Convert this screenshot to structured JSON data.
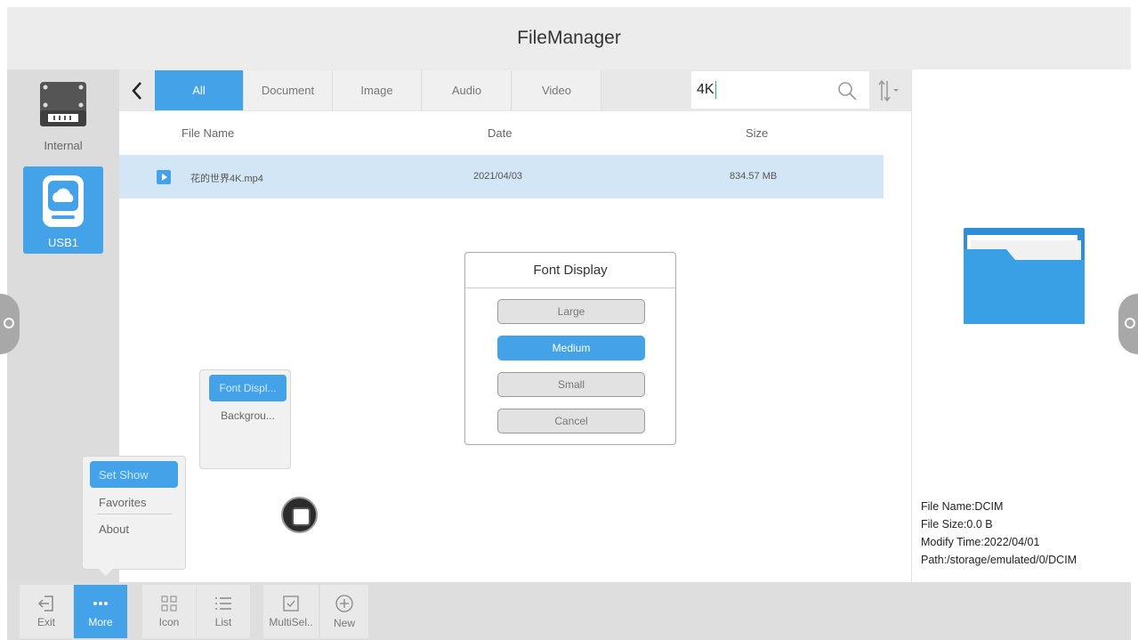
{
  "app": {
    "title": "FileManager"
  },
  "sidebar": {
    "devices": [
      {
        "label": "Internal",
        "icon": "internal-storage-icon",
        "active": false
      },
      {
        "label": "USB1",
        "icon": "usb-drive-icon",
        "active": true
      }
    ]
  },
  "tabs": [
    {
      "label": "All",
      "active": true
    },
    {
      "label": "Document",
      "active": false
    },
    {
      "label": "Image",
      "active": false
    },
    {
      "label": "Audio",
      "active": false
    },
    {
      "label": "Video",
      "active": false
    }
  ],
  "search": {
    "value": "4K"
  },
  "list": {
    "headers": {
      "name": "File Name",
      "date": "Date",
      "size": "Size"
    },
    "rows": [
      {
        "name": "花的世界4K.mp4",
        "date": "2021/04/03",
        "size": "834.57 MB",
        "icon": "video-file-icon"
      }
    ]
  },
  "details": {
    "file_name": "File Name:DCIM",
    "file_size": "File Size:0.0 B",
    "modify_time": "Modify Time:2022/04/01",
    "path": "Path:/storage/emulated/0/DCIM"
  },
  "dialog": {
    "title": "Font Display",
    "options": [
      "Large",
      "Medium",
      "Small"
    ],
    "selected": "Medium",
    "cancel": "Cancel"
  },
  "submenu": {
    "items": [
      "Font Displ...",
      "Backgrou..."
    ]
  },
  "more_menu": {
    "items": [
      "Set Show",
      "Favorites",
      "About"
    ]
  },
  "toolbar": {
    "exit": "Exit",
    "more": "More",
    "icon": "Icon",
    "list": "List",
    "multisel": "MultiSel..",
    "new": "New"
  },
  "colors": {
    "accent": "#43a2e8",
    "selected_row": "#d3e6f6"
  }
}
